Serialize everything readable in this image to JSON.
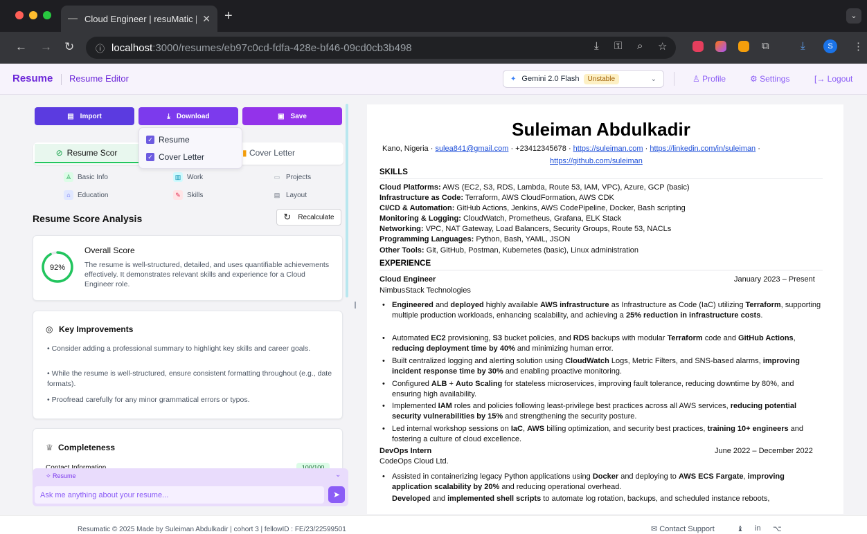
{
  "browser": {
    "tab_title": "Cloud Engineer | resuMatic | r",
    "url_host": "localhost",
    "url_path": ":3000/resumes/eb97c0cd-fdfa-428e-bf46-09cd0cb3b498"
  },
  "header": {
    "logo": "Resume",
    "breadcrumb": "Resume Editor",
    "model_name": "Gemini 2.0 Flash",
    "model_badge": "Unstable",
    "profile": "Profile",
    "settings": "Settings",
    "logout": "Logout"
  },
  "toolbar": {
    "import": "Import",
    "download": "Download",
    "save": "Save"
  },
  "download_menu": {
    "resume": "Resume",
    "cover_letter": "Cover Letter"
  },
  "tabs": {
    "resume_score": "Resume Scor",
    "cover_letter": "Cover Letter"
  },
  "sections": {
    "basic_info": "Basic Info",
    "work": "Work",
    "projects": "Projects",
    "education": "Education",
    "skills": "Skills",
    "layout": "Layout"
  },
  "analysis": {
    "title": "Resume Score Analysis",
    "recalculate": "Recalculate",
    "score": "92%",
    "score_value": 92,
    "overall_title": "Overall Score",
    "overall_desc": "The resume is well-structured, detailed, and uses quantifiable achievements effectively. It demonstrates relevant skills and experience for a Cloud Engineer role.",
    "key_title": "Key Improvements",
    "improvements": [
      "Consider adding a professional summary to highlight key skills and career goals.",
      "While the resume is well-structured, ensure consistent formatting throughout (e.g., date formats).",
      "Proofread carefully for any minor grammatical errors or typos."
    ],
    "completeness_title": "Completeness",
    "contact_label": "Contact Information",
    "contact_score": "100/100"
  },
  "chat": {
    "label": "Resume",
    "placeholder": "Ask me anything about your resume..."
  },
  "resume": {
    "name": "Suleiman Abdulkadir",
    "location": "Kano, Nigeria",
    "email": "sulea841@gmail.com",
    "phone": "+23412345678",
    "website": "https://suleiman.com",
    "linkedin": "https://linkedin.com/in/suleiman",
    "github": "https://github.com/suleiman",
    "skills_heading": "SKILLS",
    "skills": [
      {
        "label": "Cloud Platforms:",
        "value": "AWS (EC2, S3, RDS, Lambda, Route 53, IAM, VPC), Azure, GCP (basic)"
      },
      {
        "label": "Infrastructure as Code:",
        "value": "Terraform, AWS CloudFormation, AWS CDK"
      },
      {
        "label": "CI/CD & Automation:",
        "value": "GitHub Actions, Jenkins, AWS CodePipeline, Docker, Bash scripting"
      },
      {
        "label": "Monitoring & Logging:",
        "value": "CloudWatch, Prometheus, Grafana, ELK Stack"
      },
      {
        "label": "Networking:",
        "value": "VPC, NAT Gateway, Load Balancers, Security Groups, Route 53, NACLs"
      },
      {
        "label": "Programming Languages:",
        "value": "Python, Bash, YAML, JSON"
      },
      {
        "label": "Other Tools:",
        "value": "Git, GitHub, Postman, Kubernetes (basic), Linux administration"
      }
    ],
    "experience_heading": "EXPERIENCE",
    "job1_title": "Cloud Engineer",
    "job1_dates": "January 2023 – Present",
    "job1_company": "NimbusStack Technologies",
    "job2_title": "DevOps Intern",
    "job2_dates": "June 2022 – December 2022",
    "job2_company": "CodeOps Cloud Ltd."
  },
  "footer": {
    "text": "Resumatic © 2025   Made by Suleiman Abdulkadir | cohort 3 | fellowID : FE/23/22599501",
    "contact_support": "Contact Support"
  },
  "colors": {
    "brand": "#6d28d9",
    "accent": "#8b5cf6",
    "success": "#22c55e"
  }
}
